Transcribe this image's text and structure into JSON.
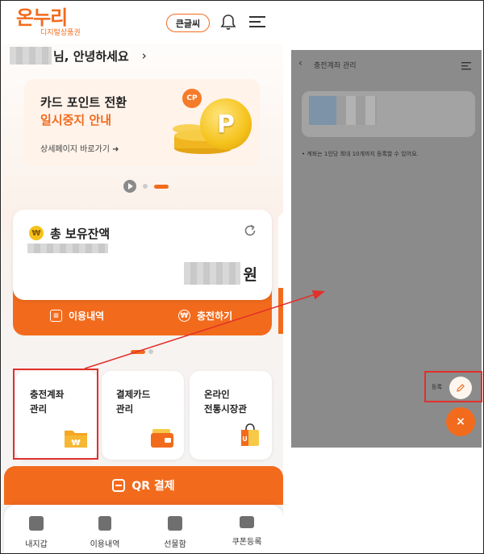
{
  "header": {
    "logo_text": "온누리",
    "logo_sub": "디지털상품권",
    "bigfont_label": "큰글씨"
  },
  "greeting": {
    "text": "님, 안녕하세요",
    "chevron": "›"
  },
  "banner": {
    "line1": "카드 포인트 전환",
    "line2": "일시중지 안내",
    "link": "상세페이지 바로가기 ➜",
    "coin_letter": "P",
    "tag": "CP"
  },
  "balance": {
    "title": "총 보유잔액",
    "unit": "원",
    "actions": [
      "이용내역",
      "충전하기"
    ]
  },
  "tiles": [
    {
      "line1": "충전계좌",
      "line2": "관리",
      "icon": "folder-won-icon"
    },
    {
      "line1": "결제카드",
      "line2": "관리",
      "icon": "wallet-card-icon"
    },
    {
      "line1": "온라인",
      "line2": "전통시장관",
      "icon": "shopping-bag-icon"
    }
  ],
  "qr_label": "QR 결제",
  "tabbar": [
    "내지갑",
    "이용내역",
    "선물함",
    "쿠폰등록"
  ],
  "account_screen": {
    "title": "충전계좌 관리",
    "note": "• 계좌는 1인당 최대 10개까지 등록할 수 있어요.",
    "register_label": "등록",
    "close": "×"
  },
  "colors": {
    "brand": "#f26b1d",
    "highlight": "#e2302a",
    "overlay": "#8b8b8b"
  }
}
